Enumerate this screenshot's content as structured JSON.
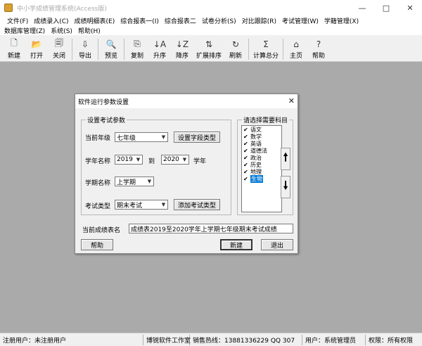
{
  "window": {
    "title": "中小学成绩管理系统(Access版)"
  },
  "menu": {
    "row1": [
      "文件(F)",
      "成绩录入(C)",
      "成绩明细表(E)",
      "综合报表一(I)",
      "综合报表二",
      "试卷分析(S)",
      "对比跟踪(R)",
      "考试管理(W)",
      "学籍管理(X)"
    ],
    "row2": [
      "数据库管理(Z)",
      "系统(S)",
      "帮助(H)"
    ]
  },
  "toolbar": [
    {
      "label": "新建",
      "icon": "new-document-icon"
    },
    {
      "label": "打开",
      "icon": "open-folder-icon"
    },
    {
      "label": "关闭",
      "icon": "close-document-icon"
    },
    {
      "label": "导出",
      "icon": "export-icon"
    },
    {
      "label": "预览",
      "icon": "print-preview-icon"
    },
    {
      "label": "复制",
      "icon": "copy-icon"
    },
    {
      "label": "升序",
      "icon": "sort-ascending-icon"
    },
    {
      "label": "降序",
      "icon": "sort-descending-icon"
    },
    {
      "label": "扩展排序",
      "icon": "extended-sort-icon"
    },
    {
      "label": "刷新",
      "icon": "refresh-icon"
    },
    {
      "label": "计算总分",
      "icon": "sigma-icon"
    },
    {
      "label": "主页",
      "icon": "home-icon"
    },
    {
      "label": "帮助",
      "icon": "help-icon"
    }
  ],
  "dialog": {
    "title": "软件运行参数设置",
    "settings_group": "设置考试参数",
    "grade_label": "当前年级",
    "grade_value": "七年级",
    "set_subject_type_button": "设置字段类型",
    "year_label": "学年名称",
    "year_start": "2019",
    "year_to": "到",
    "year_end": "2020",
    "year_suffix": "学年",
    "term_label": "学期名称",
    "term_value": "上学期",
    "exam_type_label": "考试类型",
    "exam_type_value": "期末考试",
    "add_exam_type_button": "添加考试类型",
    "subjects_group": "请选择需要科目",
    "subjects": [
      "语文",
      "数学",
      "英语",
      "道德法",
      "政治",
      "历史",
      "地理",
      "生物"
    ],
    "selected_subject_index": 7,
    "table_name_label": "当前成绩表名",
    "table_name_value": "成绩表2019至2020学年上学期七年级期末考试成绩",
    "help_button": "帮助",
    "new_button": "新建",
    "exit_button": "退出"
  },
  "status": {
    "user": "注册用户：未注册用户",
    "studio": "博锐软件工作室",
    "hotline": "销售热线：13881336229 QQ 307",
    "current_user": "用户：系统管理员",
    "permission": "权限：所有权限"
  },
  "colors": {
    "workspace": "#aaaaaa",
    "selection": "#0078d7"
  }
}
